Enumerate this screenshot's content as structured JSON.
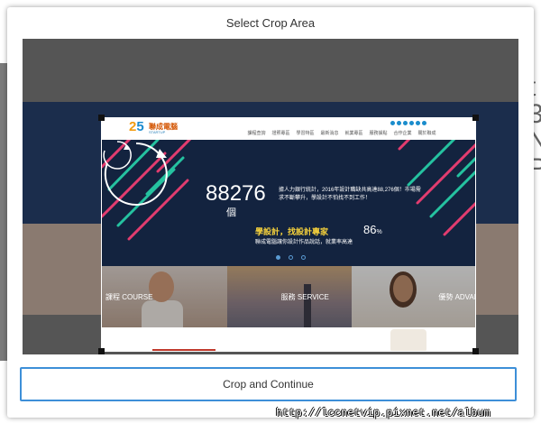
{
  "modal": {
    "title": "Select Crop Area",
    "crop_button_label": "Crop and Continue"
  },
  "background_page": {
    "edge_letters": [
      "t",
      "3",
      "N",
      "P"
    ]
  },
  "site": {
    "logo": {
      "number_a": "2",
      "number_b": "5",
      "name": "聯成電腦",
      "sub": "STARTUP"
    },
    "nav": [
      "課程查詢",
      "證照專區",
      "學習特區",
      "最新消息",
      "就業專區",
      "服務據點",
      "合作企業",
      "關於聯成"
    ],
    "hero": {
      "counter_value": "88276",
      "counter_unit": "個",
      "copy": "據人力銀行統計，2016年設計職缺共高達88,276個！市場需求不斷攀升，學設計不怕找不到工作！",
      "slogan": "學設計，找設計專家",
      "slogan_sub": "聯成電腦讓你設計作品說話，就業率高達",
      "percent_value": "86",
      "percent_unit": "%"
    },
    "panels": [
      {
        "label": "課程 COURSE"
      },
      {
        "label": "服務 SERVICE"
      },
      {
        "label": "優勢 ADVANTAGE"
      }
    ]
  },
  "colors": {
    "accent_blue": "#3d8fd8",
    "hero_bg": "#13233f",
    "stripe_pink": "#e23c6f",
    "stripe_teal": "#25c2a0",
    "slogan_yellow": "#f7d23b"
  },
  "watermark": "http://lccnetvip.pixnet.net/album"
}
